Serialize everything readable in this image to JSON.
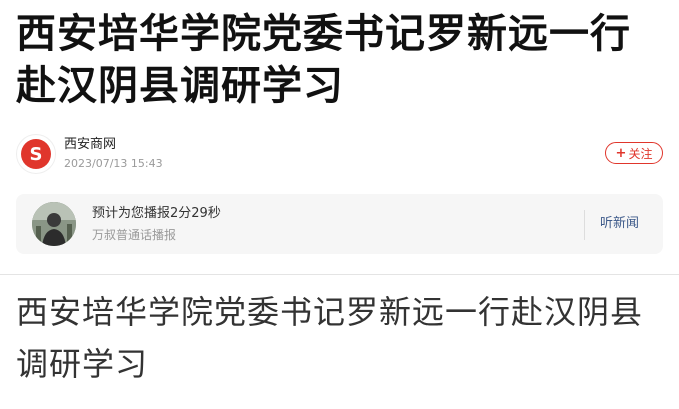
{
  "article": {
    "headline": "西安培华学院党委书记罗新远一行赴汉阴县调研学习",
    "body_title": "西安培华学院党委书记罗新远一行赴汉阴县调研学习"
  },
  "source": {
    "name": "西安商网",
    "time": "2023/07/13 15:43",
    "logo_icon": "red-s-logo-icon",
    "logo_letter": "S"
  },
  "follow": {
    "plus": "+",
    "label": "关注"
  },
  "audio": {
    "title": "预计为您播报2分29秒",
    "subtitle": "万叔普通话播报",
    "listen_label": "听新闻",
    "avatar_icon": "narrator-avatar-icon"
  },
  "colors": {
    "accent": "#e0362c",
    "link": "#3d5a8a",
    "muted": "#9a9a9a",
    "card_bg": "#f6f6f6"
  }
}
